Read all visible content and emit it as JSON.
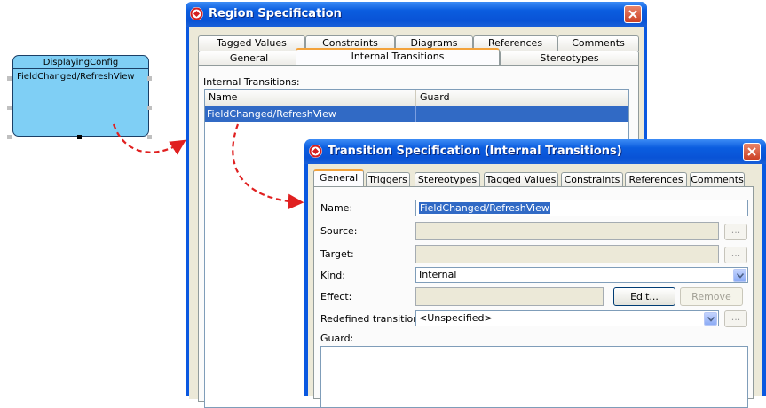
{
  "state": {
    "name": "DisplayingConfig",
    "internal_transition": "FieldChanged/RefreshView"
  },
  "region_dialog": {
    "title": "Region Specification",
    "tabs_row1": [
      "Tagged Values",
      "Constraints",
      "Diagrams",
      "References",
      "Comments"
    ],
    "tabs_row2": [
      "General",
      "Internal Transitions",
      "Stereotypes"
    ],
    "active_tab": "Internal Transitions",
    "section_label": "Internal Transitions:",
    "table": {
      "columns": [
        "Name",
        "Guard"
      ],
      "rows": [
        {
          "name": "FieldChanged/RefreshView",
          "guard": ""
        }
      ]
    }
  },
  "transition_dialog": {
    "title": "Transition Specification (Internal Transitions)",
    "tabs": [
      "General",
      "Triggers",
      "Stereotypes",
      "Tagged Values",
      "Constraints",
      "References",
      "Comments"
    ],
    "active_tab": "General",
    "fields": {
      "name_label": "Name:",
      "name_value": "FieldChanged/RefreshView",
      "source_label": "Source:",
      "source_value": "",
      "target_label": "Target:",
      "target_value": "",
      "kind_label": "Kind:",
      "kind_value": "Internal",
      "effect_label": "Effect:",
      "effect_value": "",
      "edit_button": "Edit...",
      "remove_button": "Remove",
      "redefined_label": "Redefined transition:",
      "redefined_value": "<Unspecified>",
      "guard_label": "Guard:",
      "dots": "..."
    }
  },
  "colors": {
    "titlebar": "#0b5ddf",
    "selection": "#316ac5",
    "state_fill": "#7fcff5",
    "arrow": "#e02020",
    "active_tab_accent": "#f3a23a"
  }
}
